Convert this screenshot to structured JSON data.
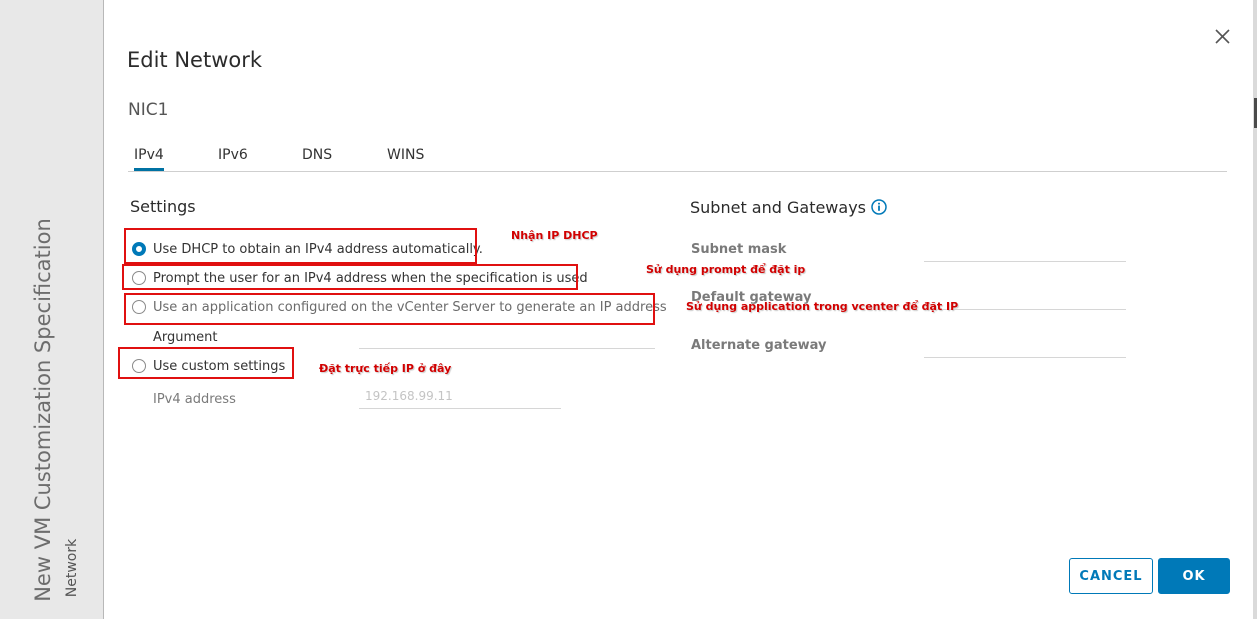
{
  "sidebar": {
    "title": "New VM Customization Specification",
    "subtitle": "Network"
  },
  "dialog": {
    "title": "Edit Network",
    "nic": "NIC1"
  },
  "tabs": [
    "IPv4",
    "IPv6",
    "DNS",
    "WINS"
  ],
  "settings": {
    "heading": "Settings",
    "options": [
      "Use DHCP to obtain an IPv4 address automatically.",
      "Prompt the user for an IPv4 address when the specification is used",
      "Use an application configured on the vCenter Server to generate an IP address",
      "Use custom settings"
    ],
    "selected_index": 0,
    "argument_label": "Argument",
    "ipv4_label": "IPv4 address",
    "ipv4_placeholder": "192.168.99.11"
  },
  "subnet": {
    "heading": "Subnet and Gateways",
    "subnet_mask_label": "Subnet mask",
    "default_gateway_label": "Default gateway",
    "alternate_gateway_label": "Alternate gateway"
  },
  "annotations": [
    "Nhận IP DHCP",
    "Sử dụng prompt để đặt ip",
    "Sử dụng application trong vcenter để đặt IP",
    "Đặt trực tiếp IP ở đây"
  ],
  "buttons": {
    "cancel": "CANCEL",
    "ok": "OK"
  },
  "colors": {
    "accent": "#0079b8",
    "annotation": "#e01010"
  },
  "icons": {
    "close": "close-icon",
    "info": "info-icon"
  }
}
